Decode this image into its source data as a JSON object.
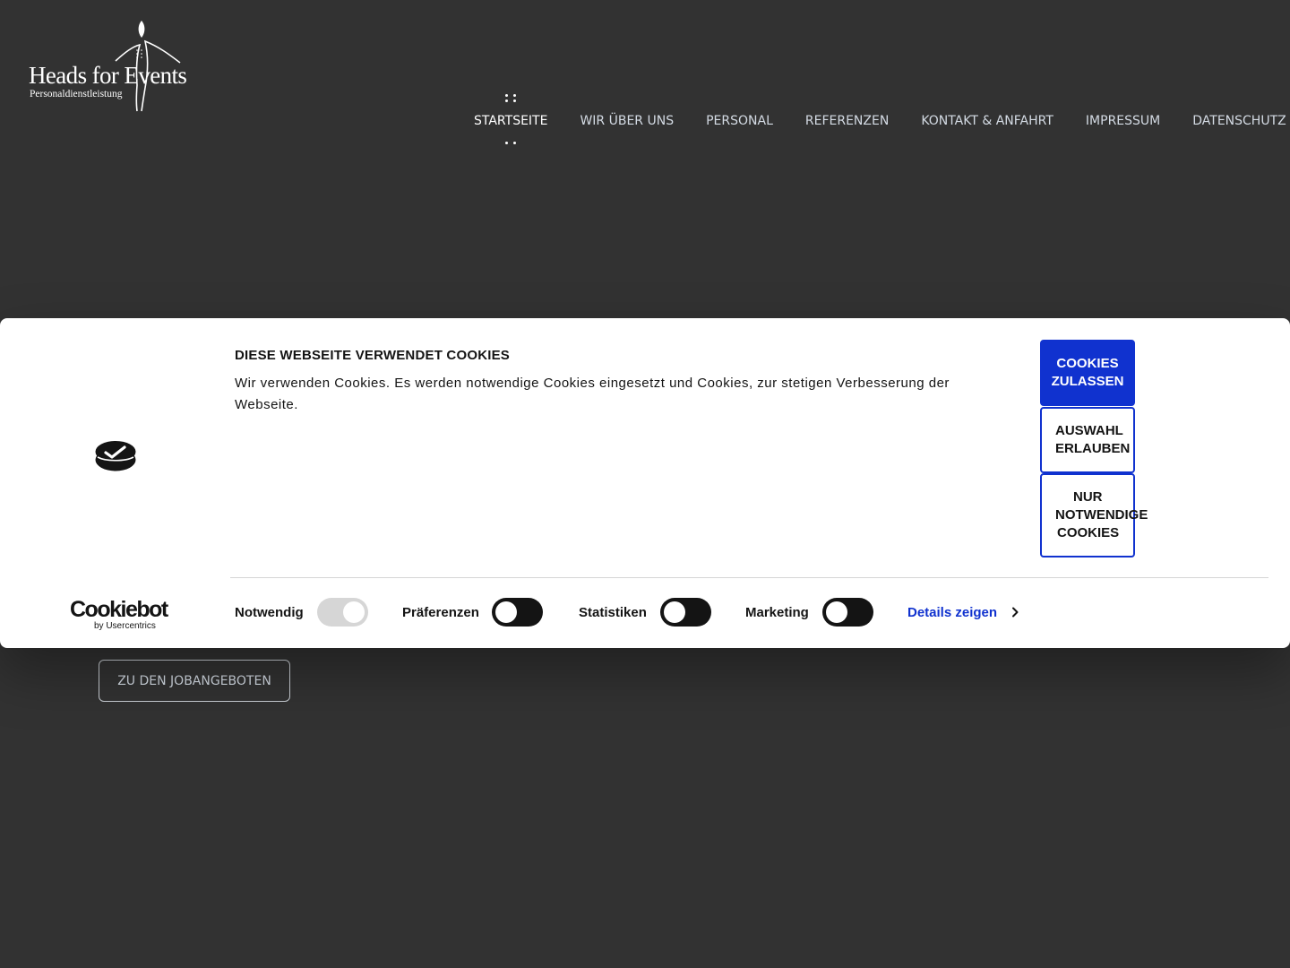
{
  "header": {
    "logo": {
      "name": "Heads for Events",
      "tagline": "Personaldienstleistung"
    },
    "nav": [
      {
        "label": "STARTSEITE",
        "active": true
      },
      {
        "label": "WIR ÜBER UNS",
        "active": false
      },
      {
        "label": "PERSONAL",
        "active": false
      },
      {
        "label": "REFERENZEN",
        "active": false
      },
      {
        "label": "KONTAKT & ANFAHRT",
        "active": false
      },
      {
        "label": "IMPRESSUM",
        "active": false
      },
      {
        "label": "DATENSCHUTZ",
        "active": false
      }
    ]
  },
  "hero": {
    "button_label": "ZU DEN JOBANGEBOTEN"
  },
  "cookie_banner": {
    "title": "DIESE WEBSEITE VERWENDET COOKIES",
    "text": "Wir verwenden Cookies. Es werden notwendige Cookies eingesetzt und Cookies, zur stetigen Verbesserung der Webseite.",
    "buttons": {
      "allow_all": [
        "COOKIES",
        "ZULASSEN"
      ],
      "allow_selection": [
        "AUSWAHL",
        "ERLAUBEN"
      ],
      "necessary_only": [
        "NUR",
        "NOTWENDIGE",
        "COOKIES"
      ]
    },
    "toggles": [
      {
        "label": "Notwendig",
        "enabled": true,
        "disabled": true
      },
      {
        "label": "Präferenzen",
        "enabled": false,
        "disabled": false
      },
      {
        "label": "Statistiken",
        "enabled": false,
        "disabled": false
      },
      {
        "label": "Marketing",
        "enabled": false,
        "disabled": false
      }
    ],
    "details_label": "Details zeigen",
    "brand": {
      "name": "Cookiebot",
      "sub": "by Usercentrics"
    }
  },
  "colors": {
    "page_background": "#323232",
    "accent_blue": "#1032cf",
    "nav_text": "#d4dbe4",
    "toggle_dark": "#141414",
    "toggle_disabled": "#d6d6d6"
  },
  "icons": [
    "logo-figure-icon",
    "cookiebot-icon",
    "chevron-right-icon"
  ]
}
